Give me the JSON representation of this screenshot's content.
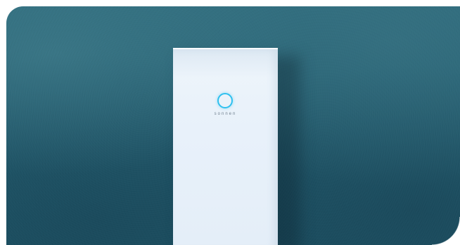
{
  "scene": {
    "description_color_wall": "#2a6677",
    "device_color": "#e8f1fa",
    "status_light_color": "#2ec0ef"
  },
  "device": {
    "brand_logo_text": "sonnen"
  }
}
